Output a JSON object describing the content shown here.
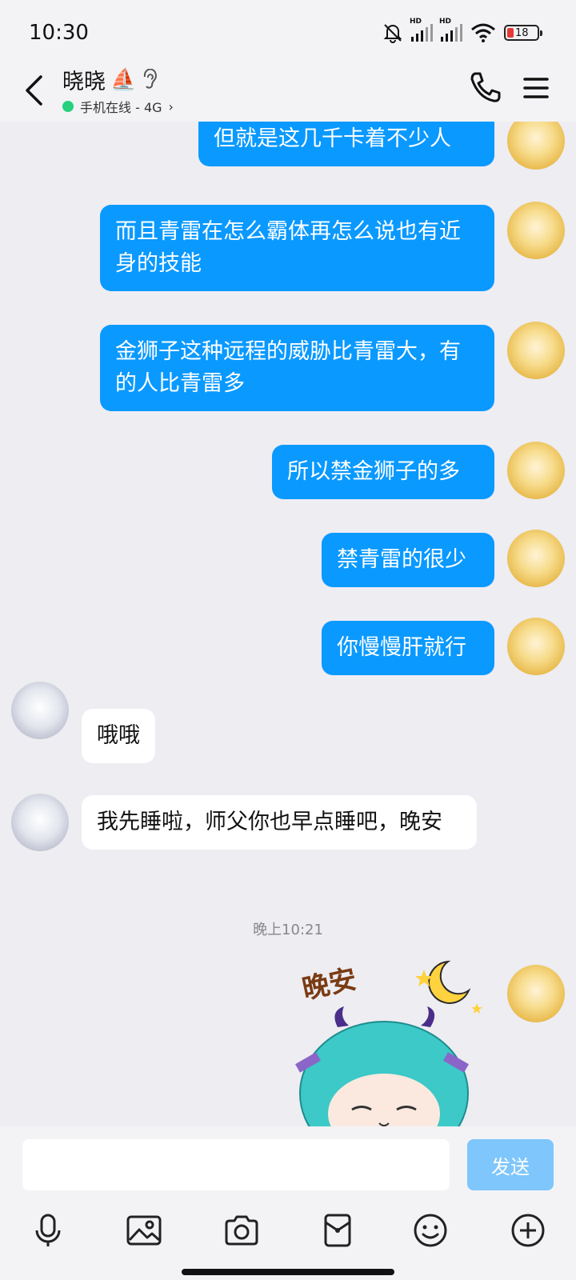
{
  "status_bar": {
    "time": "10:30",
    "battery": "18",
    "signal_label": "HD"
  },
  "header": {
    "contact_name": "晓晓",
    "name_emoji": "⛵",
    "status": "手机在线 - 4G",
    "status_chevron": "›",
    "online_color": "#26d07c"
  },
  "messages": [
    {
      "side": "out",
      "text": "但就是这几千卡着不少人"
    },
    {
      "side": "out",
      "text": "而且青雷在怎么霸体再怎么说也有近身的技能"
    },
    {
      "side": "out",
      "text": "金狮子这种远程的威胁比青雷大，有的人比青雷多"
    },
    {
      "side": "out",
      "text": "所以禁金狮子的多"
    },
    {
      "side": "out",
      "text": "禁青雷的很少"
    },
    {
      "side": "out",
      "text": "你慢慢肝就行"
    },
    {
      "side": "in",
      "text": "哦哦"
    },
    {
      "side": "in",
      "text": "我先睡啦，师父你也早点睡吧，晚安"
    }
  ],
  "timestamp": "晚上10:21",
  "sticker": {
    "text": "晚安",
    "description_icon": "goodnight-sticker"
  },
  "input": {
    "placeholder": "",
    "send_label": "发送"
  },
  "toolbar": [
    "mic-icon",
    "image-icon",
    "camera-icon",
    "red-packet-icon",
    "emoji-icon",
    "plus-icon"
  ],
  "colors": {
    "outgoing_bubble": "#0a99ff",
    "incoming_bubble": "#ffffff",
    "send_button": "#7ec6fb",
    "background": "#ededf2"
  }
}
